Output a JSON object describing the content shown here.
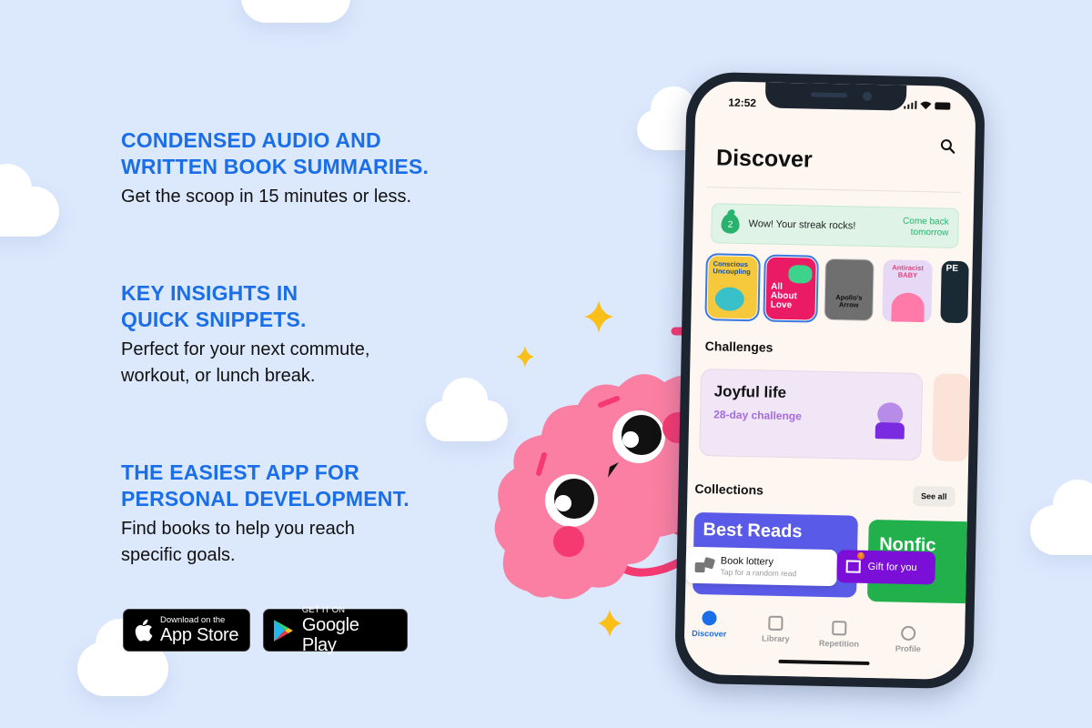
{
  "features": [
    {
      "heading_line1": "CONDENSED AUDIO AND",
      "heading_line2": "WRITTEN BOOK SUMMARIES.",
      "body_line1": "Get the scoop in 15 minutes or less.",
      "body_line2": ""
    },
    {
      "heading_line1": "KEY INSIGHTS IN",
      "heading_line2": "QUICK SNIPPETS.",
      "body_line1": "Perfect for your next commute,",
      "body_line2": "workout, or lunch break."
    },
    {
      "heading_line1": "THE EASIEST APP FOR",
      "heading_line2": "PERSONAL DEVELOPMENT.",
      "body_line1": "Find books to help you reach",
      "body_line2": "specific goals."
    }
  ],
  "stores": {
    "appstore": {
      "small": "Download on the",
      "big": "App Store",
      "icon": "apple-icon"
    },
    "googleplay": {
      "small": "GET IT ON",
      "big": "Google Play",
      "icon": "google-play-icon"
    }
  },
  "phone": {
    "status_time": "12:52",
    "title": "Discover",
    "streak": {
      "count": "2",
      "message": "Wow! Your streak rocks!",
      "cta_line1": "Come back",
      "cta_line2": "tomorrow"
    },
    "books": [
      {
        "title": "Conscious Uncoupling",
        "selected": true
      },
      {
        "title": "All About Love",
        "selected": true
      },
      {
        "title": "Apollo's Arrow",
        "selected": false
      },
      {
        "title": "Antiracist BABY",
        "selected": false
      },
      {
        "title": "PE",
        "selected": false
      }
    ],
    "challenges_header": "Challenges",
    "challenge": {
      "title": "Joyful life",
      "subtitle": "28-day challenge"
    },
    "collections_header": "Collections",
    "see_all": "See all",
    "collections": [
      {
        "title": "Best Reads"
      },
      {
        "title": "Nonfic"
      }
    ],
    "lottery": {
      "title": "Book lottery",
      "subtitle": "Tap for a random read"
    },
    "gift": {
      "label": "Gift for you",
      "badge": "!"
    },
    "tabs": [
      {
        "label": "Discover",
        "active": true,
        "icon": "compass-icon"
      },
      {
        "label": "Library",
        "active": false,
        "icon": "bookmark-icon"
      },
      {
        "label": "Repetition",
        "active": false,
        "icon": "cards-icon"
      },
      {
        "label": "Profile",
        "active": false,
        "icon": "profile-icon"
      }
    ]
  },
  "colors": {
    "background": "#dce8fc",
    "heading_blue": "#1a6ee8",
    "streak_green": "#27b36c",
    "challenge_purple": "#a46ae0",
    "gift_purple": "#7b0fd8",
    "mascot_pink": "#fb7fa2"
  }
}
